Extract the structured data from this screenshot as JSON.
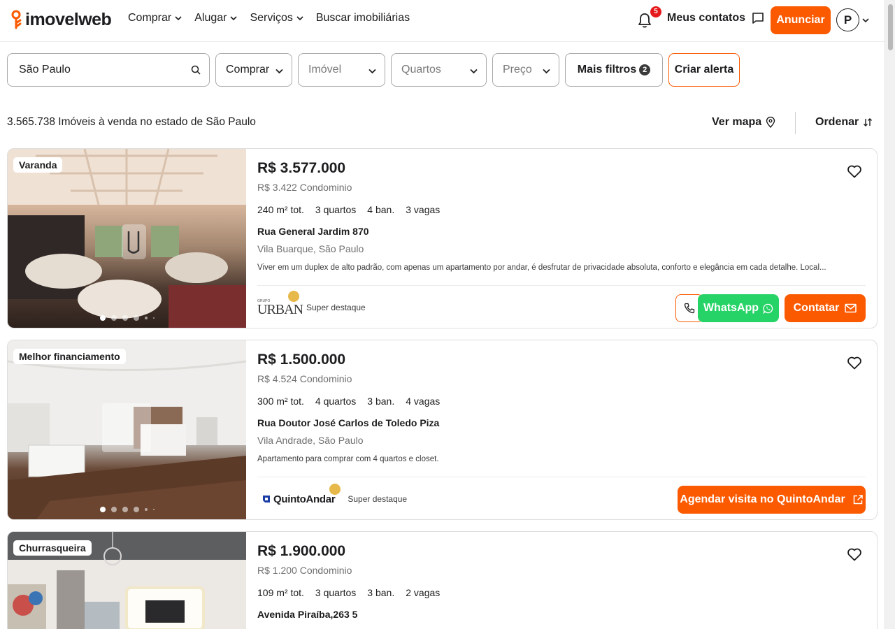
{
  "colors": {
    "brand": "#fb5a01",
    "whatsapp": "#25d366",
    "badge": "#e5191b"
  },
  "header": {
    "logo_text": "imovelweb",
    "nav": [
      "Comprar",
      "Alugar",
      "Serviços",
      "Buscar imobiliárias"
    ],
    "notifications_count": "5",
    "contacts_label": "Meus contatos",
    "anunciar_label": "Anunciar",
    "avatar_initial": "P"
  },
  "filters": {
    "search_value": "São Paulo",
    "operation": "Comprar",
    "property_type_placeholder": "Imóvel",
    "rooms_placeholder": "Quartos",
    "price_placeholder": "Preço",
    "more_filters_label": "Mais filtros",
    "more_filters_count": "2",
    "create_alert_label": "Criar alerta"
  },
  "results": {
    "count_text": "3.565.738 Imóveis à venda no estado de São Paulo",
    "map_label": "Ver mapa",
    "sort_label": "Ordenar"
  },
  "listings": [
    {
      "tag": "Varanda",
      "price": "R$ 3.577.000",
      "condo": "R$ 3.422 Condominio",
      "features": [
        "240 m² tot.",
        "3 quartos",
        "4 ban.",
        "3 vagas"
      ],
      "address": "Rua General Jardim 870",
      "location": "Vila Buarque, São Paulo",
      "description": "Viver em um duplex de alto padrão, com apenas um apartamento por andar, é desfrutar de privacidade absoluta, conforto e elegância em cada detalhe. Local...",
      "publisher_logo_text": "URBAN",
      "publisher_logo_small": "GRUPO",
      "publisher_label": "Super destaque",
      "whatsapp_label": "WhatsApp",
      "contact_label": "Contatar"
    },
    {
      "tag": "Melhor financiamento",
      "price": "R$ 1.500.000",
      "condo": "R$ 4.524 Condominio",
      "features": [
        "300 m² tot.",
        "4 quartos",
        "3 ban.",
        "4 vagas"
      ],
      "address": "Rua Doutor José Carlos de Toledo Piza",
      "location": "Vila Andrade, São Paulo",
      "description": "Apartamento para comprar com 4 quartos e closet.",
      "publisher_logo_text": "QuintoAndar",
      "publisher_label": "Super destaque",
      "schedule_label": "Agendar visita no QuintoAndar"
    },
    {
      "tag": "Churrasqueira",
      "price": "R$ 1.900.000",
      "condo": "R$ 1.200 Condominio",
      "features": [
        "109 m² tot.",
        "3 quartos",
        "3 ban.",
        "2 vagas"
      ],
      "address": "Avenida Piraíba,263 5"
    }
  ],
  "icons": [
    "logo-pin-icon",
    "chevron-down-icon",
    "bell-icon",
    "chat-icon",
    "search-icon",
    "map-pin-icon",
    "sort-icon",
    "heart-icon",
    "phone-icon",
    "whatsapp-icon",
    "mail-icon",
    "external-link-icon",
    "crown-icon"
  ]
}
